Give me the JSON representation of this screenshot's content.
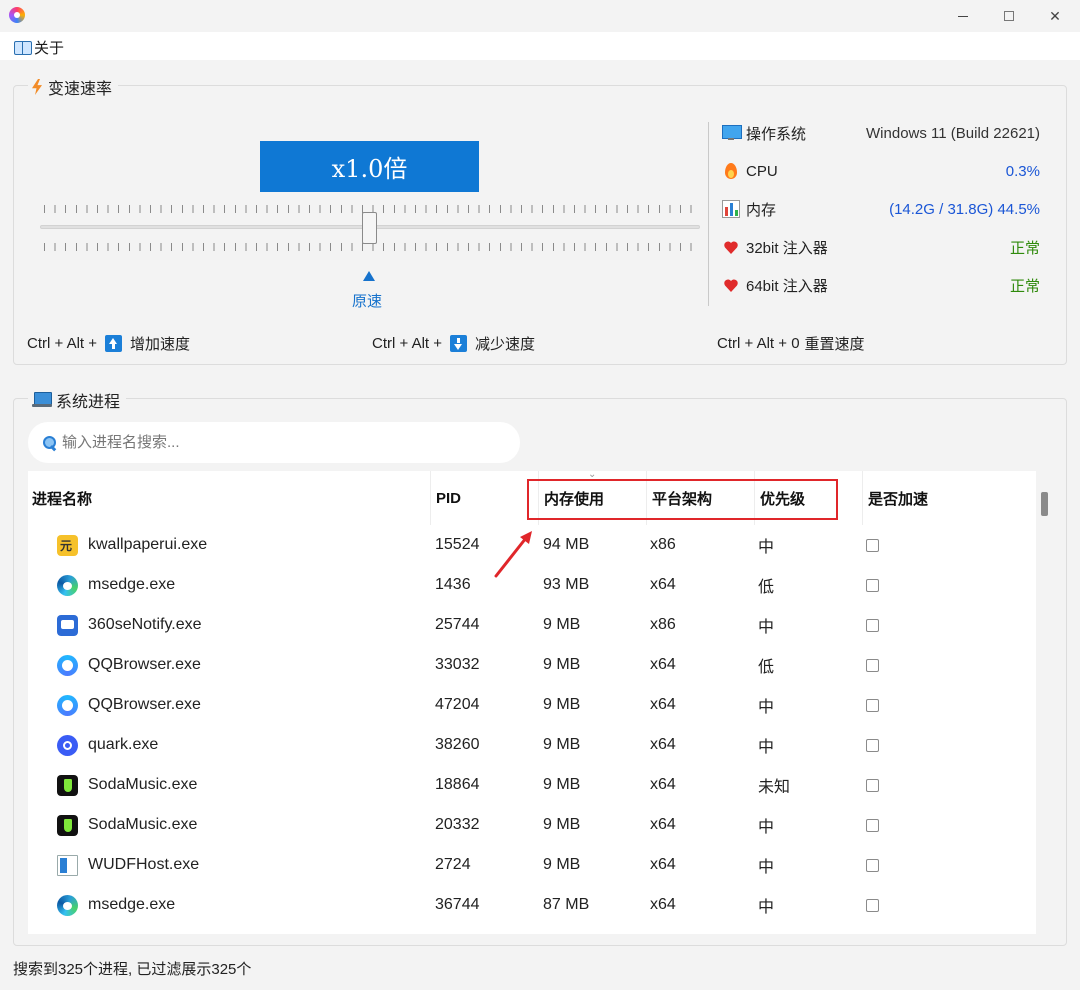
{
  "window": {
    "minimize": "—",
    "maximize": "□",
    "close": "✕"
  },
  "menu": {
    "about": "关于"
  },
  "speed_group": {
    "title": "变速速率",
    "speed_display": "x1.0倍",
    "slider": {
      "value": 1.0,
      "position_fraction": 0.5
    },
    "origin_label": "原速"
  },
  "system_info": [
    {
      "icon": "monitor-icon",
      "label": "操作系统",
      "value": "Windows 11 (Build 22621)",
      "color": "#333333"
    },
    {
      "icon": "flame-icon",
      "label": "CPU",
      "value": "0.3%",
      "color": "#1a56d6"
    },
    {
      "icon": "memory-chart-icon",
      "label": "内存",
      "value": "(14.2G / 31.8G) 44.5%",
      "color": "#1a56d6"
    },
    {
      "icon": "heart-icon",
      "label": "32bit 注入器",
      "value": "正常",
      "color": "#2f8a0b"
    },
    {
      "icon": "heart-icon",
      "label": "64bit 注入器",
      "value": "正常",
      "color": "#2f8a0b"
    }
  ],
  "hotkeys": [
    {
      "prefix": "Ctrl + Alt +",
      "key_icon": "arrow-up-icon",
      "action": "增加速度"
    },
    {
      "prefix": "Ctrl + Alt +",
      "key_icon": "arrow-down-icon",
      "action": "减少速度"
    },
    {
      "prefix": "Ctrl + Alt + 0",
      "action": "重置速度"
    }
  ],
  "process_group": {
    "title": "系统进程",
    "search_placeholder": "输入进程名搜索...",
    "columns": [
      "进程名称",
      "PID",
      "内存使用",
      "平台架构",
      "优先级",
      "是否加速"
    ],
    "rows": [
      {
        "icon": "kwallpaper-icon",
        "name": "kwallpaperui.exe",
        "pid": "15524",
        "memory": "94 MB",
        "arch": "x86",
        "priority": "中",
        "accelerated": false
      },
      {
        "icon": "edge-icon",
        "name": "msedge.exe",
        "pid": "1436",
        "memory": "93 MB",
        "arch": "x64",
        "priority": "低",
        "accelerated": false
      },
      {
        "icon": "360-notify-icon",
        "name": "360seNotify.exe",
        "pid": "25744",
        "memory": "9 MB",
        "arch": "x86",
        "priority": "中",
        "accelerated": false
      },
      {
        "icon": "qqbrowser-icon",
        "name": "QQBrowser.exe",
        "pid": "33032",
        "memory": "9 MB",
        "arch": "x64",
        "priority": "低",
        "accelerated": false
      },
      {
        "icon": "qqbrowser-icon",
        "name": "QQBrowser.exe",
        "pid": "47204",
        "memory": "9 MB",
        "arch": "x64",
        "priority": "中",
        "accelerated": false
      },
      {
        "icon": "quark-icon",
        "name": "quark.exe",
        "pid": "38260",
        "memory": "9 MB",
        "arch": "x64",
        "priority": "中",
        "accelerated": false
      },
      {
        "icon": "sodamusic-icon",
        "name": "SodaMusic.exe",
        "pid": "18864",
        "memory": "9 MB",
        "arch": "x64",
        "priority": "未知",
        "accelerated": false
      },
      {
        "icon": "sodamusic-icon",
        "name": "SodaMusic.exe",
        "pid": "20332",
        "memory": "9 MB",
        "arch": "x64",
        "priority": "中",
        "accelerated": false
      },
      {
        "icon": "wudfhost-icon",
        "name": "WUDFHost.exe",
        "pid": "2724",
        "memory": "9 MB",
        "arch": "x64",
        "priority": "中",
        "accelerated": false
      },
      {
        "icon": "edge-icon",
        "name": "msedge.exe",
        "pid": "36744",
        "memory": "87 MB",
        "arch": "x64",
        "priority": "中",
        "accelerated": false
      }
    ]
  },
  "status_bar": "搜索到325个进程, 已过滤展示325个",
  "colors": {
    "accent": "#0f78d4",
    "annotation": "#e0262a",
    "ok": "#2f8a0b",
    "metric": "#1a56d6"
  }
}
